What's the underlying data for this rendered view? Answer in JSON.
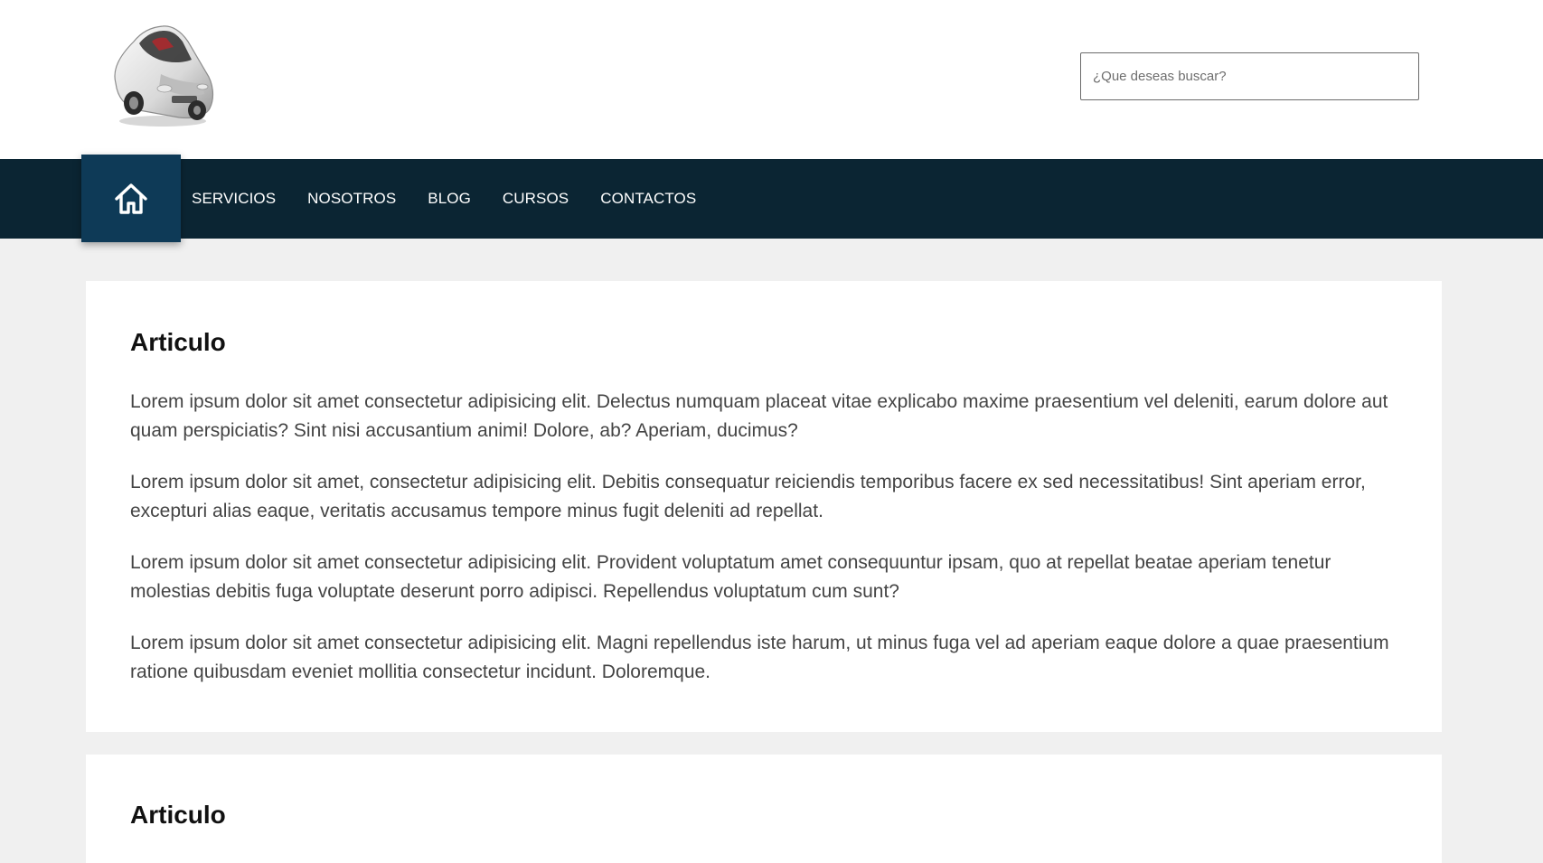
{
  "search": {
    "placeholder": "¿Que deseas buscar?"
  },
  "nav": {
    "home_icon": "home-icon",
    "items": [
      {
        "label": "SERVICIOS"
      },
      {
        "label": "NOSOTROS"
      },
      {
        "label": "BLOG"
      },
      {
        "label": "CURSOS"
      },
      {
        "label": "CONTACTOS"
      }
    ]
  },
  "articles": [
    {
      "title": "Articulo",
      "paragraphs": [
        "Lorem ipsum dolor sit amet consectetur adipisicing elit. Delectus numquam placeat vitae explicabo maxime praesentium vel deleniti, earum dolore aut quam perspiciatis? Sint nisi accusantium animi! Dolore, ab? Aperiam, ducimus?",
        "Lorem ipsum dolor sit amet, consectetur adipisicing elit. Debitis consequatur reiciendis temporibus facere ex sed necessitatibus! Sint aperiam error, excepturi alias eaque, veritatis accusamus tempore minus fugit deleniti ad repellat.",
        "Lorem ipsum dolor sit amet consectetur adipisicing elit. Provident voluptatum amet consequuntur ipsam, quo at repellat beatae aperiam tenetur molestias debitis fuga voluptate deserunt porro adipisci. Repellendus voluptatum cum sunt?",
        "Lorem ipsum dolor sit amet consectetur adipisicing elit. Magni repellendus iste harum, ut minus fuga vel ad aperiam eaque dolore a quae praesentium ratione quibusdam eveniet mollitia consectetur incidunt. Doloremque."
      ]
    },
    {
      "title": "Articulo"
    }
  ],
  "colors": {
    "navbar": "#0b2533",
    "home_button": "#0e3a57",
    "page_background": "#f0f0f0"
  }
}
